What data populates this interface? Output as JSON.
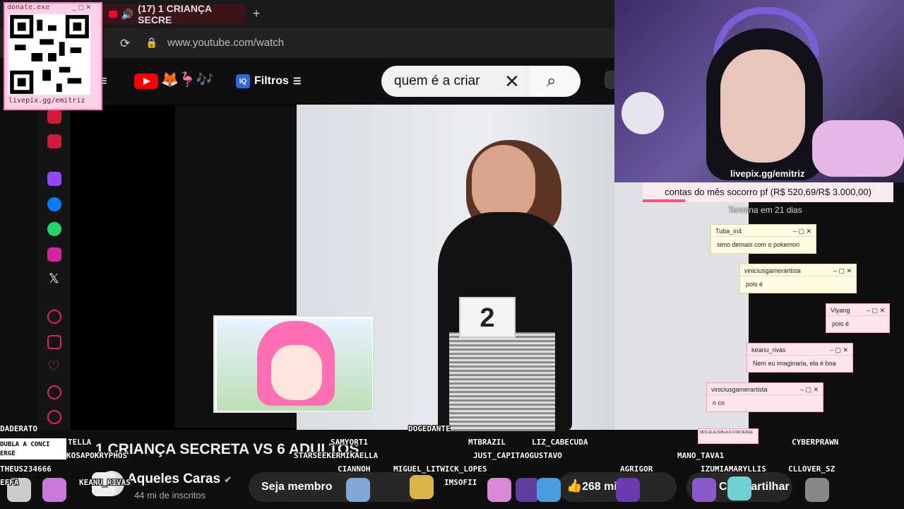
{
  "browser": {
    "tab_title": "(17) 1 CRIANÇA SECRE",
    "url": "www.youtube.com/watch",
    "new_tab": "+"
  },
  "youtube": {
    "filtros_label": "Filtros",
    "search_value": "quem é a criar",
    "video_title": "1 CRIANÇA SECRETA VS 6 ADULTOS",
    "channel_name": "Aqueles Caras",
    "subscribers": "44 mi de inscritos",
    "join_label": "Seja membro",
    "likes_label": "268 mil",
    "share_label": "Compartilhar",
    "badge_number": "2"
  },
  "overlay": {
    "qr_window_title": "donate.exe",
    "qr_url": "livepix.gg/emitriz",
    "cam_label": "livepix.gg/emitriz",
    "goal_text": "contas do mês socorro pf (R$ 520,69/R$ 3.000,00)",
    "goal_progress": 0.17,
    "goal_sub": "Termina em 21 dias",
    "chat": [
      {
        "user": "Tuba_in4",
        "text": "simo demais com o pokemon"
      },
      {
        "user": "viniciusgamerartista",
        "text": "pois é"
      },
      {
        "user": "Vlyang",
        "text": "pois é"
      },
      {
        "user": "keanu_rivas",
        "text": "Nem eu imaginaria, ela é boa"
      },
      {
        "user": "viniciusgamerartista",
        "text": "n cn"
      }
    ],
    "mini_chat": "MDS ELA DUBLA A CONCIERGE",
    "nicks": [
      "DOGEDANTE",
      "SAMYORT1",
      "MTBRAZIL",
      "LIZ_CABECUDA",
      "CYBERPRAWN",
      "STARSEEKERMIKAELLA",
      "JUST_CAPITAOGUSTAVO",
      "MANO_TAVA1",
      "CIANNOH",
      "MIGUEL_LITWICK_LOPES",
      "AGRIGOR",
      "IZUMIAMARYLLIS",
      "CLLOVER_SZ",
      "KEANU_RIVAS",
      "IMSOFII",
      "KOSAPOKRYPHOS",
      "THEUS234666",
      "TELLA",
      "DADERATO",
      "DUBLA A CONCI",
      "ERGE",
      "EFFA"
    ]
  }
}
